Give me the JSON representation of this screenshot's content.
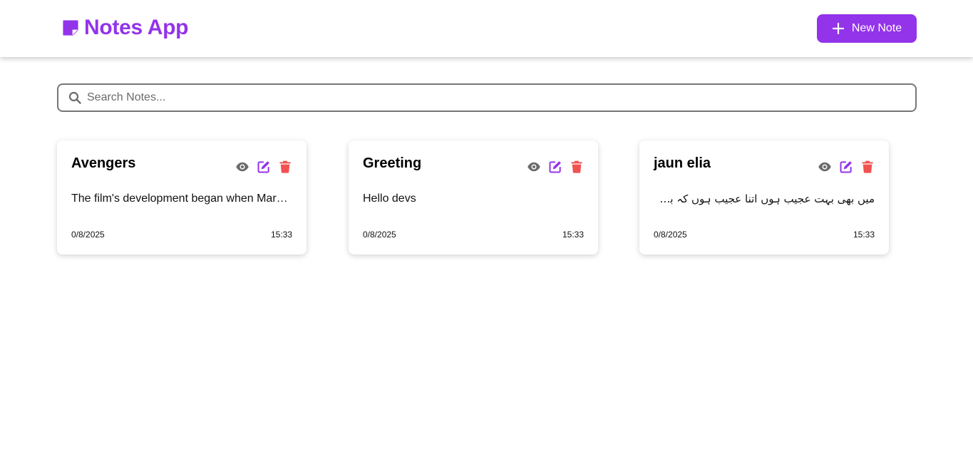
{
  "app": {
    "title": "Notes App",
    "brand_color": "#9333ea",
    "logo_icon": "sticky-note-icon"
  },
  "header": {
    "new_note_label": "New Note",
    "new_note_icon": "plus-icon"
  },
  "search": {
    "placeholder": "Search Notes...",
    "value": "",
    "icon": "search-icon"
  },
  "notes": [
    {
      "title": "Avengers",
      "content": "The film's development began when Marvel Studios received a loan from Merrill Lynch",
      "date": "0/8/2025",
      "time": "15:33"
    },
    {
      "title": "Greeting",
      "content": "Hello devs",
      "date": "0/8/2025",
      "time": "15:33"
    },
    {
      "title": "jaun elia",
      "content": "میں بھی بہت عجیب ہوں اتنا عجیب ہوں کہ بس خود کو تباہ کر لیا اور ملال بھی نہیں",
      "date": "0/8/2025",
      "time": "15:33"
    }
  ],
  "actions": {
    "view_icon": "eye-icon",
    "edit_icon": "edit-icon",
    "delete_icon": "trash-icon",
    "view_color": "#6b6b6b",
    "edit_color": "#9333ea",
    "delete_color": "#f05252"
  }
}
